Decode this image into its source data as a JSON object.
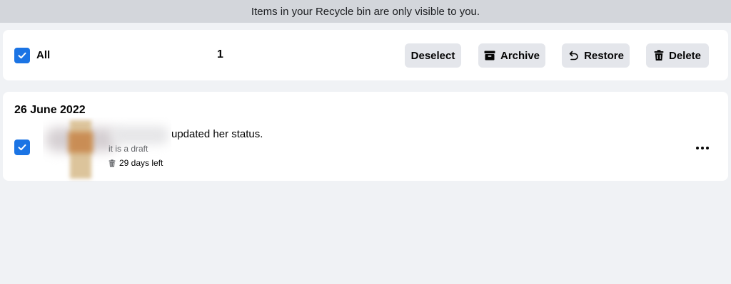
{
  "banner": {
    "text": "Items in your Recycle bin are only visible to you."
  },
  "toolbar": {
    "select_all": {
      "label": "All",
      "checked": true
    },
    "selected_count": "1",
    "buttons": {
      "deselect": "Deselect",
      "archive": "Archive",
      "restore": "Restore",
      "delete": "Delete"
    }
  },
  "feed": {
    "date": "26 June 2022",
    "item": {
      "checked": true,
      "activity": "updated her status.",
      "subtext": "it is a draft",
      "days_left": "29 days left"
    }
  },
  "colors": {
    "accent": "#1b74e4",
    "button_bg": "#e4e6eb",
    "banner_bg": "#d3d6db",
    "page_bg": "#f0f2f5"
  }
}
